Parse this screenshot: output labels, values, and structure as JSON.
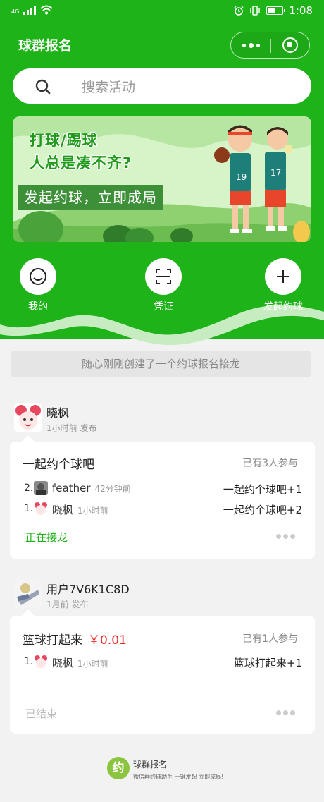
{
  "status_bar": {
    "network": "4G",
    "time": "1:08"
  },
  "app": {
    "title": "球群报名"
  },
  "search": {
    "placeholder": "搜索活动"
  },
  "banner": {
    "line1": "打球/踢球",
    "line2": "人总是凑不齐?",
    "slogan": "发起约球，立即成局",
    "jersey_left": "19",
    "jersey_right": "17"
  },
  "quick_actions": [
    {
      "label": "我的",
      "icon": "smile-icon"
    },
    {
      "label": "凭证",
      "icon": "scan-icon"
    },
    {
      "label": "发起约球",
      "icon": "plus-icon"
    }
  ],
  "notice": "随心刚刚创建了一个约球报名接龙",
  "posts": [
    {
      "author": "晓枫",
      "time": "1小时前 发布",
      "title": "一起约个球吧",
      "price": "",
      "participants": "已有3人参与",
      "entries": [
        {
          "idx": "2.",
          "name": "feather",
          "time": "42分钟前",
          "message": "一起约个球吧+1"
        },
        {
          "idx": "1.",
          "name": "晓枫",
          "time": "1小时前",
          "message": "一起约个球吧+2"
        }
      ],
      "status": "正在接龙"
    },
    {
      "author": "用户7V6K1C8D",
      "time": "1月前 发布",
      "title": "篮球打起来",
      "price": "￥0.01",
      "participants": "已有1人参与",
      "entries": [
        {
          "idx": "1.",
          "name": "晓枫",
          "time": "1小时前",
          "message": "篮球打起来+1"
        }
      ],
      "status": "已结束"
    }
  ],
  "footer": {
    "logo_text": "约",
    "name": "球群报名",
    "subtitle": "微信群约球助手 一键发起 立即成局!"
  },
  "colors": {
    "primary": "#1fb31a",
    "price": "#e52a24"
  }
}
